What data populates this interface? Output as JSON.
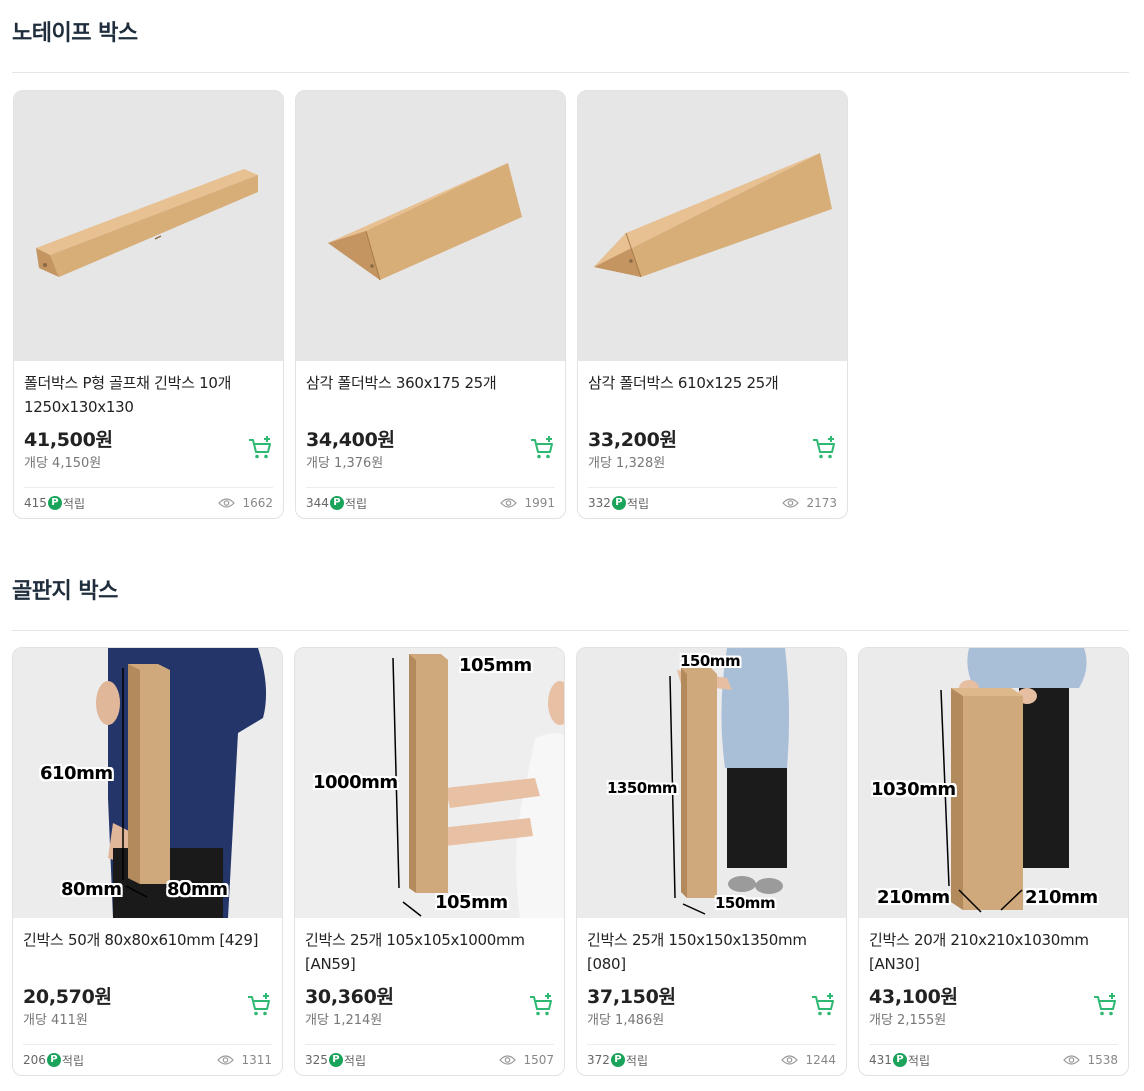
{
  "sections": [
    {
      "title": "노테이프 박스",
      "products": [
        {
          "name": "폴더박스 P형 골프채 긴박스 10개 1250x130x130",
          "price": "41,500원",
          "unit_price": "개당 4,150원",
          "points": "415",
          "points_label": "적립",
          "views": "1662"
        },
        {
          "name": "삼각 폴더박스 360x175 25개",
          "price": "34,400원",
          "unit_price": "개당 1,376원",
          "points": "344",
          "points_label": "적립",
          "views": "1991"
        },
        {
          "name": "삼각 폴더박스 610x125 25개",
          "price": "33,200원",
          "unit_price": "개당 1,328원",
          "points": "332",
          "points_label": "적립",
          "views": "2173"
        }
      ]
    },
    {
      "title": "골판지 박스",
      "products": [
        {
          "name": "긴박스 50개 80x80x610mm [429]",
          "price": "20,570원",
          "unit_price": "개당 411원",
          "points": "206",
          "points_label": "적립",
          "views": "1311",
          "dims": [
            "610mm",
            "80mm",
            "80mm"
          ]
        },
        {
          "name": "긴박스 25개 105x105x1000mm [AN59]",
          "price": "30,360원",
          "unit_price": "개당 1,214원",
          "points": "325",
          "points_label": "적립",
          "views": "1507",
          "dims": [
            "105mm",
            "1000mm",
            "105mm"
          ]
        },
        {
          "name": "긴박스 25개 150x150x1350mm [080]",
          "price": "37,150원",
          "unit_price": "개당 1,486원",
          "points": "372",
          "points_label": "적립",
          "views": "1244",
          "dims": [
            "150mm",
            "1350mm",
            "150mm"
          ]
        },
        {
          "name": "긴박스 20개 210x210x1030mm [AN30]",
          "price": "43,100원",
          "unit_price": "개당 2,155원",
          "points": "431",
          "points_label": "적립",
          "views": "1538",
          "dims": [
            "1030mm",
            "210mm",
            "210mm"
          ]
        }
      ]
    }
  ],
  "badge_letter": "P",
  "colors": {
    "accent_green": "#1aa35a",
    "cart_green": "#2eb872",
    "title": "#1f2d3d",
    "kraft": "#d7ad78"
  }
}
